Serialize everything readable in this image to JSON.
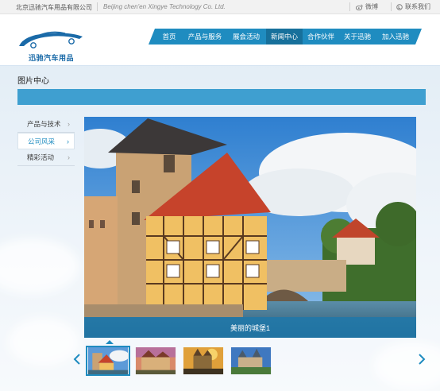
{
  "topbar": {
    "company_cn": "北京迅驰汽车用品有限公司",
    "company_en": "Beijing chen'en Xingye Technology Co. Ltd.",
    "weibo": "微博",
    "contact": "联系我们"
  },
  "logo": {
    "text": "迅驰汽车用品"
  },
  "nav": {
    "items": [
      {
        "label": "首页",
        "active": false
      },
      {
        "label": "产品与服务",
        "active": false
      },
      {
        "label": "展会活动",
        "active": false
      },
      {
        "label": "新闻中心",
        "active": true
      },
      {
        "label": "合作伙伴",
        "active": false
      },
      {
        "label": "关于迅驰",
        "active": false
      },
      {
        "label": "加入迅驰",
        "active": false
      }
    ]
  },
  "page": {
    "title": "图片中心"
  },
  "sidebar": {
    "items": [
      {
        "label": "产品与技术",
        "active": false
      },
      {
        "label": "公司风采",
        "active": true
      },
      {
        "label": "精彩活动",
        "active": false
      }
    ]
  },
  "gallery": {
    "caption": "美丽的城堡1",
    "thumbnail_count": 4,
    "selected_index": 0
  },
  "colors": {
    "accent": "#1f8cc0",
    "accent_dark": "#17709b",
    "title_bar": "#3f9fd0"
  }
}
